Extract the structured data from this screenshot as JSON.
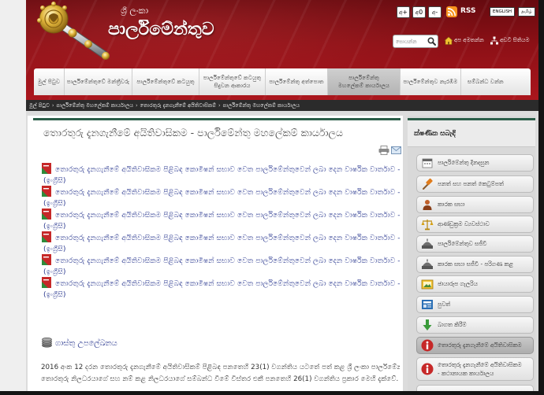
{
  "header": {
    "country": "ශ්‍රී ලංකා",
    "title": "පාර්ලිමේන්තුව",
    "font_buttons": [
      "අ+",
      "අ0",
      "අ-"
    ],
    "rss_label": "RSS",
    "lang_buttons": [
      "ENGLISH",
      "தமிழ்"
    ],
    "search_placeholder": "සොයන්න",
    "contact_label": "අප අමතන්න",
    "sitemap_label": "අඩවි සිතියම"
  },
  "nav": {
    "active_index": 5,
    "tabs": [
      {
        "label": "මුල් පිටුව"
      },
      {
        "label": "පාර්ලිමේන්තුවේ මන්ත්‍රීවරු"
      },
      {
        "label": "පාර්ලිමේන්තුවේ කටයුතු"
      },
      {
        "label": "පාර්ලිමේන්තුවේ කටයුතු\nසිදුවන ආකාරය"
      },
      {
        "label": "පාර්ලිමේන්තු අත්පොත"
      },
      {
        "label": "පාර්ලිමේන්තු\nමහලේකම් කාර්යාලය"
      },
      {
        "label": "පාර්ලිමේන්තුව නැරඹීම"
      },
      {
        "label": "සම්බන්ධ වන්න"
      }
    ]
  },
  "breadcrumb": {
    "separator": "›",
    "items": [
      "මුල් පිටුව",
      "පාර්ලිමේන්තු මහලේකම් කාර්යාලය",
      "තොරතුරු දැනගැනීමේ අයිතිවාසිකම්",
      "පාර්ලිමේන්තු මහලේකම් කාර්යාලය"
    ]
  },
  "main": {
    "title": "තොරතුරු දැනගැනීමේ අයිතිවාසිකම - පාර්ලිමේන්තු මහලේකම් කාර්යාලය",
    "documents": [
      {
        "text": "තොරතුරු දැනගැනීමේ අයිතිවාසිකම පිළිබඳ කොමිෂන් සභාව වෙත පාර්ලිමේන්තුවෙන් ලබා දෙන වාර්ෂික වාර්තාව - 2017",
        "lang": "(ඉංග්‍රීසි)"
      },
      {
        "text": "තොරතුරු දැනගැනීමේ අයිතිවාසිකම පිළිබඳ කොමිෂන් සභාව වෙත පාර්ලිමේන්තුවෙන් ලබා දෙන වාර්ෂික වාර්තාව - 2018",
        "lang": "(ඉංග්‍රීසි)"
      },
      {
        "text": "තොරතුරු දැනගැනීමේ අයිතිවාසිකම පිළිබඳ කොමිෂන් සභාව වෙත පාර්ලිමේන්තුවෙන් ලබා දෙන වාර්ෂික වාර්තාව - 2019",
        "lang": "(ඉංග්‍රීසි)"
      },
      {
        "text": "තොරතුරු දැනගැනීමේ අයිතිවාසිකම පිළිබඳ කොමිෂන් සභාව වෙත පාර්ලිමේන්තුවෙන් ලබා දෙන වාර්ෂික වාර්තාව - 2020",
        "lang": "(ඉංග්‍රීසි)"
      },
      {
        "text": "තොරතුරු දැනගැනීමේ අයිතිවාසිකම පිළිබඳ කොමිෂන් සභාව වෙත පාර්ලිමේන්තුවෙන් ලබා දෙන වාර්ෂික වාර්තාව - 2021",
        "lang": "(ඉංග්‍රීසි)"
      },
      {
        "text": "තොරතුරු දැනගැනීමේ අයිතිවාසිකම පිළිබඳ කොමිෂන් සභාව වෙත පාර්ලිමේන්තුවෙන් ලබා දෙන වාර්ෂික වාර්තාව - 2022",
        "lang": "(ඉංග්‍රීසි)"
      }
    ],
    "fees_label": "ගාස්තු උපලේඛනය",
    "paragraph_lines": [
      "2016 අංක 12 දරන තොරතුරු දැනගැනීමේ අයිතිවාසිකම් පිළිබඳ පනතෙහි 23(1) වගන්තිය යටතේ පත් කළ ශ්‍රී ලංකා පාර්ලිමේන්තුවේ",
      "තොරතුරු නිලධරයාගේ සහ නම් කළ නිලධරයාගේ සම්බන්ධ වීමේ විස්තර එකී පනතෙහි 26(1) වගන්තිය ප්‍රකාර මෙහි දැක්වේ."
    ]
  },
  "sidebar": {
    "title": "ක්ෂණික සබැඳි",
    "active_index": 9,
    "items": [
      {
        "label": "පාර්ලිමේන්තු දිනදසුන",
        "icon": "calendar-icon"
      },
      {
        "label": "පනත් සහ පනත් කෙටුම්පත්",
        "icon": "gavel-icon"
      },
      {
        "label": "කාරක සභා",
        "icon": "person-icon"
      },
      {
        "label": "ආණ්ඩුක්‍රම ව්‍යවස්ථාව",
        "icon": "scales-icon"
      },
      {
        "label": "පාර්ලිමේන්තුව සජීවී",
        "icon": "dome-icon"
      },
      {
        "label": "කාරක සභා සජීවී - පරිගණ කළ",
        "icon": "dome-icon"
      },
      {
        "label": "ඡායාරූප ගැලරිය",
        "icon": "photo-icon"
      },
      {
        "label": "පුවත්",
        "icon": "news-icon"
      },
      {
        "label": "බාගත කිරීම්",
        "icon": "download-icon"
      },
      {
        "label": "තොරතුරු දැනගැනීමේ අයිතිවාසිකම",
        "icon": "info-icon"
      },
      {
        "label": "තොරතුරු දැනගැනීමේ අයිතිවාසිකම\n- කථානායක කාර්යාලය",
        "icon": "info-icon"
      }
    ]
  },
  "colors": {
    "header_red": "#ab161d",
    "accent_green": "#2a5d48",
    "link_blue": "#2b3990",
    "breadcrumb_bg": "#2b2b2b",
    "nav_active": "#b3b3b3"
  }
}
